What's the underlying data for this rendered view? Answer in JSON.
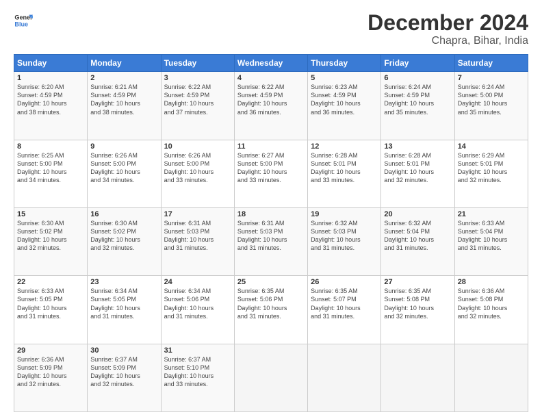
{
  "logo": {
    "line1": "General",
    "line2": "Blue"
  },
  "title": "December 2024",
  "subtitle": "Chapra, Bihar, India",
  "days_header": [
    "Sunday",
    "Monday",
    "Tuesday",
    "Wednesday",
    "Thursday",
    "Friday",
    "Saturday"
  ],
  "weeks": [
    [
      {
        "day": "1",
        "info": "Sunrise: 6:20 AM\nSunset: 4:59 PM\nDaylight: 10 hours\nand 38 minutes."
      },
      {
        "day": "2",
        "info": "Sunrise: 6:21 AM\nSunset: 4:59 PM\nDaylight: 10 hours\nand 38 minutes."
      },
      {
        "day": "3",
        "info": "Sunrise: 6:22 AM\nSunset: 4:59 PM\nDaylight: 10 hours\nand 37 minutes."
      },
      {
        "day": "4",
        "info": "Sunrise: 6:22 AM\nSunset: 4:59 PM\nDaylight: 10 hours\nand 36 minutes."
      },
      {
        "day": "5",
        "info": "Sunrise: 6:23 AM\nSunset: 4:59 PM\nDaylight: 10 hours\nand 36 minutes."
      },
      {
        "day": "6",
        "info": "Sunrise: 6:24 AM\nSunset: 4:59 PM\nDaylight: 10 hours\nand 35 minutes."
      },
      {
        "day": "7",
        "info": "Sunrise: 6:24 AM\nSunset: 5:00 PM\nDaylight: 10 hours\nand 35 minutes."
      }
    ],
    [
      {
        "day": "8",
        "info": "Sunrise: 6:25 AM\nSunset: 5:00 PM\nDaylight: 10 hours\nand 34 minutes."
      },
      {
        "day": "9",
        "info": "Sunrise: 6:26 AM\nSunset: 5:00 PM\nDaylight: 10 hours\nand 34 minutes."
      },
      {
        "day": "10",
        "info": "Sunrise: 6:26 AM\nSunset: 5:00 PM\nDaylight: 10 hours\nand 33 minutes."
      },
      {
        "day": "11",
        "info": "Sunrise: 6:27 AM\nSunset: 5:00 PM\nDaylight: 10 hours\nand 33 minutes."
      },
      {
        "day": "12",
        "info": "Sunrise: 6:28 AM\nSunset: 5:01 PM\nDaylight: 10 hours\nand 33 minutes."
      },
      {
        "day": "13",
        "info": "Sunrise: 6:28 AM\nSunset: 5:01 PM\nDaylight: 10 hours\nand 32 minutes."
      },
      {
        "day": "14",
        "info": "Sunrise: 6:29 AM\nSunset: 5:01 PM\nDaylight: 10 hours\nand 32 minutes."
      }
    ],
    [
      {
        "day": "15",
        "info": "Sunrise: 6:30 AM\nSunset: 5:02 PM\nDaylight: 10 hours\nand 32 minutes."
      },
      {
        "day": "16",
        "info": "Sunrise: 6:30 AM\nSunset: 5:02 PM\nDaylight: 10 hours\nand 32 minutes."
      },
      {
        "day": "17",
        "info": "Sunrise: 6:31 AM\nSunset: 5:03 PM\nDaylight: 10 hours\nand 31 minutes."
      },
      {
        "day": "18",
        "info": "Sunrise: 6:31 AM\nSunset: 5:03 PM\nDaylight: 10 hours\nand 31 minutes."
      },
      {
        "day": "19",
        "info": "Sunrise: 6:32 AM\nSunset: 5:03 PM\nDaylight: 10 hours\nand 31 minutes."
      },
      {
        "day": "20",
        "info": "Sunrise: 6:32 AM\nSunset: 5:04 PM\nDaylight: 10 hours\nand 31 minutes."
      },
      {
        "day": "21",
        "info": "Sunrise: 6:33 AM\nSunset: 5:04 PM\nDaylight: 10 hours\nand 31 minutes."
      }
    ],
    [
      {
        "day": "22",
        "info": "Sunrise: 6:33 AM\nSunset: 5:05 PM\nDaylight: 10 hours\nand 31 minutes."
      },
      {
        "day": "23",
        "info": "Sunrise: 6:34 AM\nSunset: 5:05 PM\nDaylight: 10 hours\nand 31 minutes."
      },
      {
        "day": "24",
        "info": "Sunrise: 6:34 AM\nSunset: 5:06 PM\nDaylight: 10 hours\nand 31 minutes."
      },
      {
        "day": "25",
        "info": "Sunrise: 6:35 AM\nSunset: 5:06 PM\nDaylight: 10 hours\nand 31 minutes."
      },
      {
        "day": "26",
        "info": "Sunrise: 6:35 AM\nSunset: 5:07 PM\nDaylight: 10 hours\nand 31 minutes."
      },
      {
        "day": "27",
        "info": "Sunrise: 6:35 AM\nSunset: 5:08 PM\nDaylight: 10 hours\nand 32 minutes."
      },
      {
        "day": "28",
        "info": "Sunrise: 6:36 AM\nSunset: 5:08 PM\nDaylight: 10 hours\nand 32 minutes."
      }
    ],
    [
      {
        "day": "29",
        "info": "Sunrise: 6:36 AM\nSunset: 5:09 PM\nDaylight: 10 hours\nand 32 minutes."
      },
      {
        "day": "30",
        "info": "Sunrise: 6:37 AM\nSunset: 5:09 PM\nDaylight: 10 hours\nand 32 minutes."
      },
      {
        "day": "31",
        "info": "Sunrise: 6:37 AM\nSunset: 5:10 PM\nDaylight: 10 hours\nand 33 minutes."
      },
      null,
      null,
      null,
      null
    ]
  ]
}
